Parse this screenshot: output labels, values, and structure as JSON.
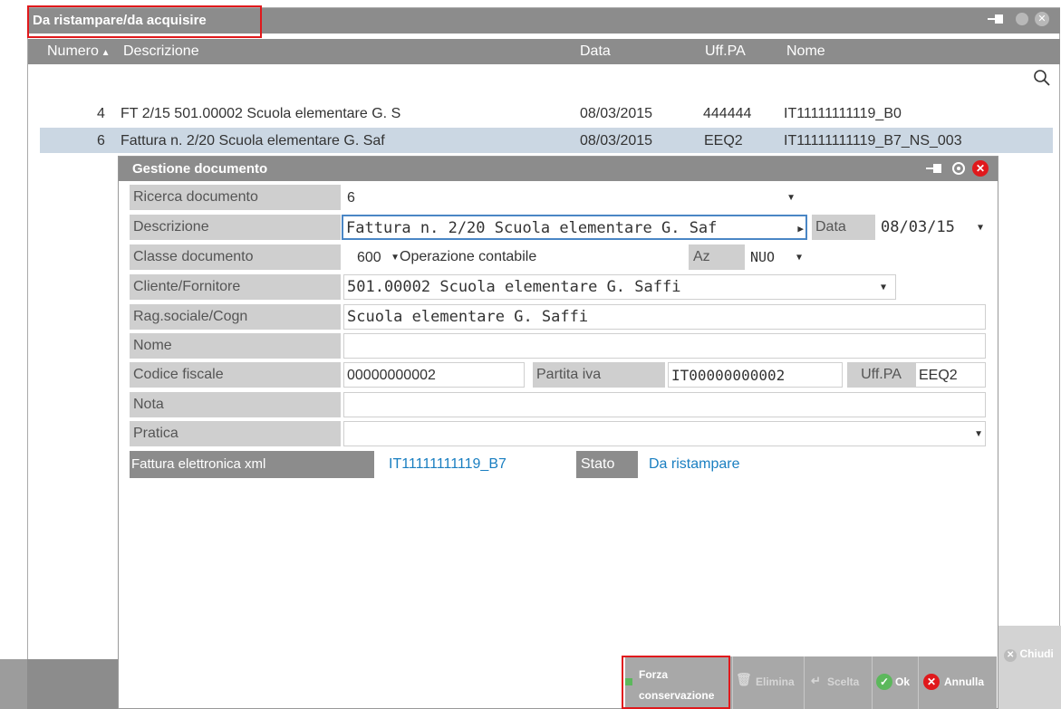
{
  "outer_window": {
    "title": "Da ristampare/da acquisire",
    "columns": [
      "Numero",
      "Descrizione",
      "Data",
      "Uff.PA",
      "Nome"
    ],
    "rows": [
      {
        "numero": "4",
        "descrizione": "FT 2/15 501.00002 Scuola elementare G. S",
        "data": "08/03/2015",
        "uffpa": "444444",
        "nome": "IT11111111119_B0"
      },
      {
        "numero": "6",
        "descrizione": "Fattura n. 2/20 Scuola elementare G. Saf",
        "data": "08/03/2015",
        "uffpa": "EEQ2",
        "nome": "IT11111111119_B7_NS_003"
      }
    ],
    "close_label": "Chiudi"
  },
  "modal": {
    "title": "Gestione documento",
    "fields": {
      "ricerca_label": "Ricerca documento",
      "ricerca_value": "6",
      "descrizione_label": "Descrizione",
      "descrizione_value": "Fattura n. 2/20 Scuola elementare G. Saf",
      "data_label": "Data",
      "data_value": "08/03/15",
      "classe_label": "Classe documento",
      "classe_value": "600",
      "operazione_label": "Operazione contabile",
      "az_label": "Az",
      "az_value": "NUO",
      "cliente_label": "Cliente/Fornitore",
      "cliente_value": "501.00002 Scuola elementare G. Saffi",
      "ragsociale_label": "Rag.sociale/Cogn",
      "ragsociale_value": "Scuola elementare G. Saffi",
      "nome_label": "Nome",
      "nome_value": "",
      "codfisc_label": "Codice fiscale",
      "codfisc_value": "00000000002",
      "piva_label": "Partita iva",
      "piva_value": "IT00000000002",
      "uffpa_label": "Uff.PA",
      "uffpa_value": "EEQ2",
      "nota_label": "Nota",
      "nota_value": "",
      "pratica_label": "Pratica",
      "pratica_value": "",
      "fattura_label": "Fattura elettronica xml",
      "fattura_value": "IT11111111119_B7",
      "stato_label": "Stato",
      "stato_value": "Da ristampare"
    },
    "toolbar": {
      "forza_line1": "Forza",
      "forza_line2": "conservazione",
      "elimina": "Elimina",
      "scelta": "Scelta",
      "ok": "Ok",
      "annulla": "Annulla"
    }
  },
  "colors": {
    "title_bar": "#8c8c8c",
    "selected_row": "#cbd7e3",
    "highlight_box": "#e0191c",
    "link_blue": "#1a7fc1",
    "ok_green": "#5cb85c",
    "cancel_red": "#e0191c"
  }
}
